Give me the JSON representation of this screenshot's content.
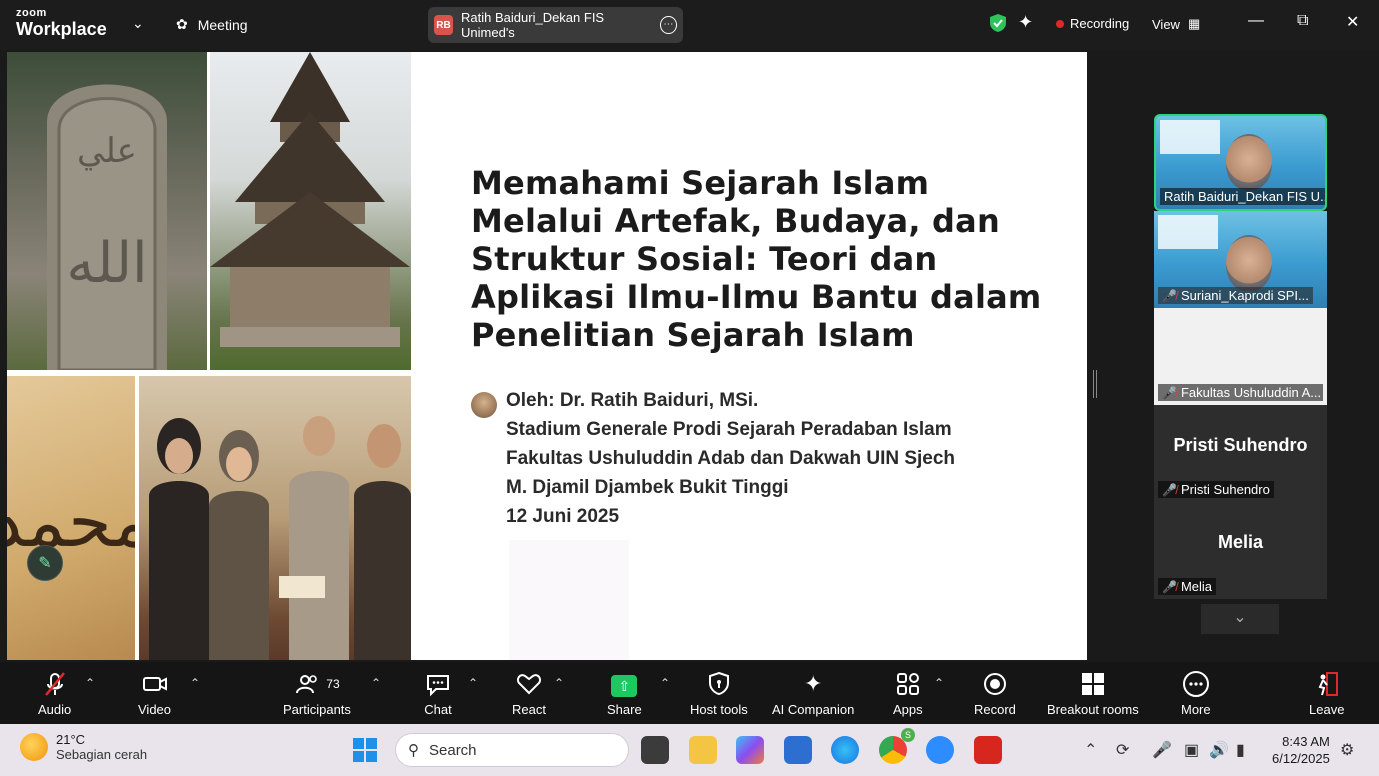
{
  "topbar": {
    "logo_top": "zoom",
    "logo_bottom": "Workplace",
    "meeting_label": "Meeting",
    "sharer_initials": "RB",
    "sharer_title": "Ratih Baiduri_Dekan FIS Unimed's",
    "recording_label": "Recording",
    "view_label": "View",
    "icons": [
      "chevron-down-icon",
      "paw-icon",
      "more-icon",
      "shield-icon",
      "sparkle-icon",
      "recording-dot-icon",
      "grid-icon",
      "minimize-icon",
      "restore-icon",
      "close-icon"
    ]
  },
  "slide": {
    "title": "Memahami Sejarah Islam Melalui Artefak, Budaya, dan Struktur Sosial: Teori dan Aplikasi Ilmu-Ilmu Bantu dalam Penelitian Sejarah Islam",
    "title_lines": [
      "Memahami Sejarah Islam",
      "Melalui Artefak, Budaya, dan",
      "Struktur Sosial: Teori dan",
      "Aplikasi Ilmu-Ilmu Bantu dalam",
      "Penelitian Sejarah Islam"
    ],
    "info_lines": [
      "Oleh:  Dr. Ratih Baiduri, MSi.",
      "Stadium Generale Prodi Sejarah Peradaban Islam",
      "Fakultas Ushuluddin Adab dan Dakwah  UIN Sjech",
      "M. Djamil Djambek Bukit Tinggi",
      "12 Juni 2025"
    ]
  },
  "gallery": {
    "tiles": [
      {
        "name": "Ratih Baiduri_Dekan FIS U...",
        "muted": false
      },
      {
        "name": "Suriani_Kaprodi SPI...",
        "muted": true
      },
      {
        "name": "Fakultas Ushuluddin A...",
        "muted": true
      },
      {
        "big": "Pristi Suhendro",
        "name": "Pristi Suhendro",
        "muted": true
      },
      {
        "big": "Melia",
        "name": "Melia",
        "muted": true
      }
    ]
  },
  "toolbar": {
    "audio": "Audio",
    "video": "Video",
    "participants": "Participants",
    "participants_count": "73",
    "chat": "Chat",
    "react": "React",
    "share": "Share",
    "host_tools": "Host tools",
    "ai_companion": "AI Companion",
    "apps": "Apps",
    "record": "Record",
    "breakout_rooms": "Breakout rooms",
    "more": "More",
    "leave": "Leave"
  },
  "taskbar": {
    "temperature": "21°C",
    "weather_desc": "Sebagian cerah",
    "search_placeholder": "Search",
    "time": "8:43 AM",
    "date": "6/12/2025",
    "chrome_badge": "S"
  },
  "colors": {
    "active_speaker_border": "#2ed37a",
    "share_green": "#1fc760",
    "recording_red": "#e02828",
    "mute_red": "#e04040"
  }
}
